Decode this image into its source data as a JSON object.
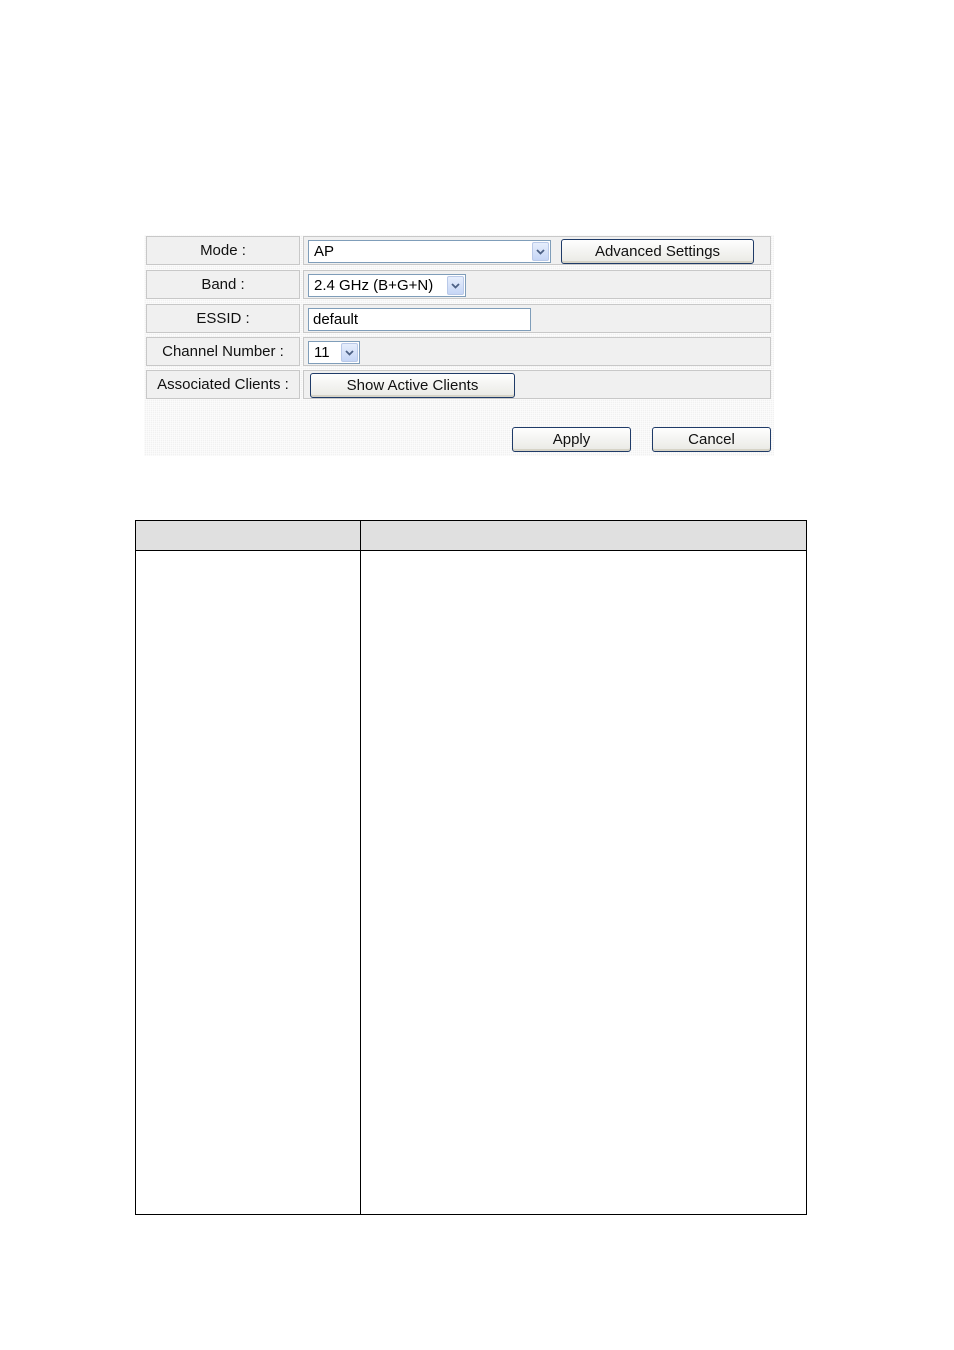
{
  "form": {
    "mode": {
      "label": "Mode :",
      "selected": "AP",
      "advanced_button": "Advanced Settings"
    },
    "band": {
      "label": "Band :",
      "selected": "2.4 GHz (B+G+N)"
    },
    "essid": {
      "label": "ESSID :",
      "value": "default"
    },
    "channel": {
      "label": "Channel Number :",
      "selected": "11"
    },
    "clients": {
      "label": "Associated Clients :",
      "button": "Show Active Clients"
    },
    "actions": {
      "apply": "Apply",
      "cancel": "Cancel"
    }
  },
  "description_table": {
    "headers": [
      "",
      ""
    ],
    "rows": [
      [
        "",
        ""
      ]
    ]
  },
  "icons": {
    "dropdown": "chevron-down-icon"
  },
  "colors": {
    "panel_background": "#f1f1f1",
    "input_border": "#7f9db9",
    "button_border": "#1f3b68",
    "arrow_color": "#4d6185",
    "table_header_background": "#e0e0e0"
  }
}
